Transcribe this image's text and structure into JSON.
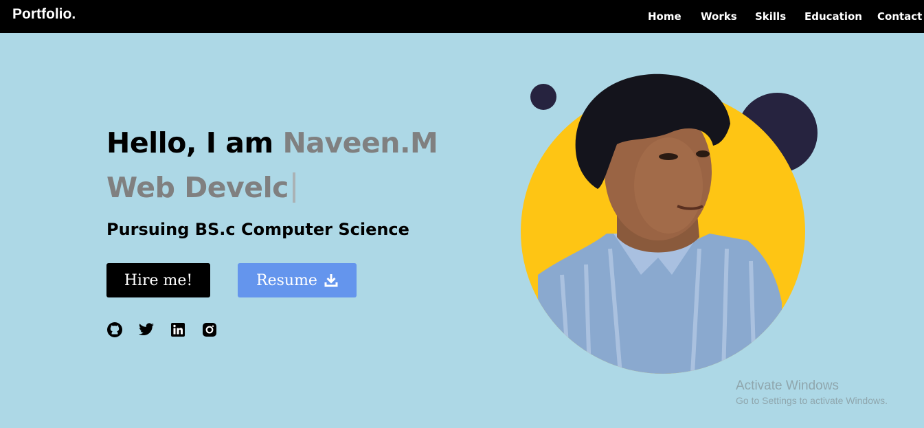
{
  "navbar": {
    "logo": "Portfolio.",
    "links": [
      "Home",
      "Works",
      "Skills",
      "Education",
      "Contact"
    ]
  },
  "hero": {
    "greeting_prefix": "Hello, I am ",
    "name": "Naveen.M",
    "typed_role": "Web Develc",
    "subtitle": "Pursuing BS.c Computer Science",
    "hire_button": "Hire me!",
    "resume_button": "Resume"
  },
  "socials": [
    "github-icon",
    "twitter-icon",
    "linkedin-icon",
    "instagram-icon"
  ],
  "colors": {
    "background": "#add8e6",
    "navbar": "#000000",
    "accent_yellow": "#fec514",
    "dark_dot": "#26233f",
    "resume_button": "#6495ed",
    "name_gray": "#808080"
  },
  "watermark": {
    "title": "Activate Windows",
    "subtitle": "Go to Settings to activate Windows."
  }
}
